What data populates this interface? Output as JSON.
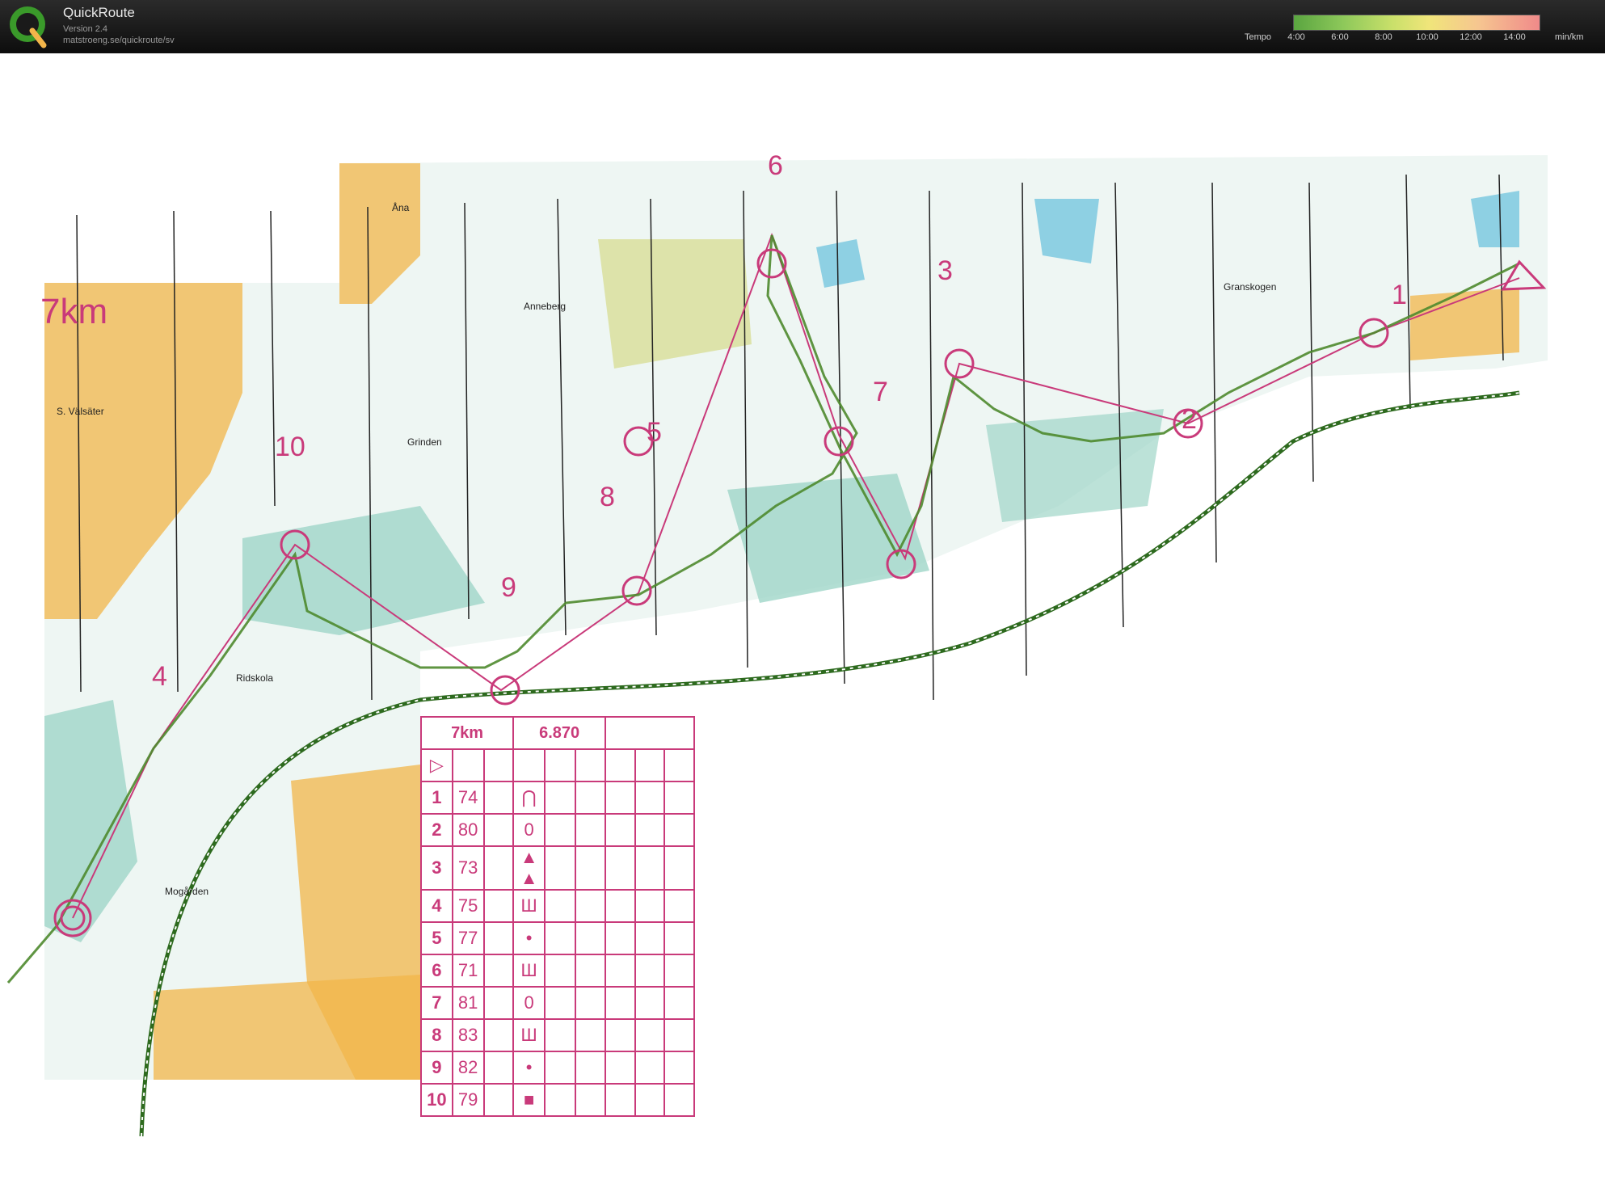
{
  "app": {
    "title": "QuickRoute",
    "version": "Version 2.4",
    "url": "matstroeng.se/quickroute/sv"
  },
  "tempo": {
    "label": "Tempo",
    "ticks": [
      "4:00",
      "6:00",
      "8:00",
      "10:00",
      "12:00",
      "14:00"
    ],
    "unit": "min/km"
  },
  "map": {
    "course_title": "7km",
    "place_names": [
      "Åna",
      "Anneberg",
      "S. Välsäter",
      "Grinden",
      "Granskogen",
      "Ridskola",
      "Mogården"
    ],
    "controls": [
      "1",
      "2",
      "3",
      "4",
      "5",
      "6",
      "7",
      "8",
      "9",
      "10"
    ]
  },
  "description_sheet": {
    "course": "7km",
    "length": "6.870",
    "rows": [
      {
        "num": "1",
        "code": "74",
        "symbol": "⋂"
      },
      {
        "num": "2",
        "code": "80",
        "symbol": "0"
      },
      {
        "num": "3",
        "code": "73",
        "symbol": "▲ ▲"
      },
      {
        "num": "4",
        "code": "75",
        "symbol": "Ш"
      },
      {
        "num": "5",
        "code": "77",
        "symbol": "•"
      },
      {
        "num": "6",
        "code": "71",
        "symbol": "Ш"
      },
      {
        "num": "7",
        "code": "81",
        "symbol": "0"
      },
      {
        "num": "8",
        "code": "83",
        "symbol": "Ш"
      },
      {
        "num": "9",
        "code": "82",
        "symbol": "•"
      },
      {
        "num": "10",
        "code": "79",
        "symbol": "■"
      }
    ]
  },
  "colors": {
    "course": "#c93a7a",
    "route": "#4e8a2e",
    "open_land": "#f2b54a",
    "marsh": "#4fb8d8",
    "forest_green": "#9fd6c8"
  }
}
